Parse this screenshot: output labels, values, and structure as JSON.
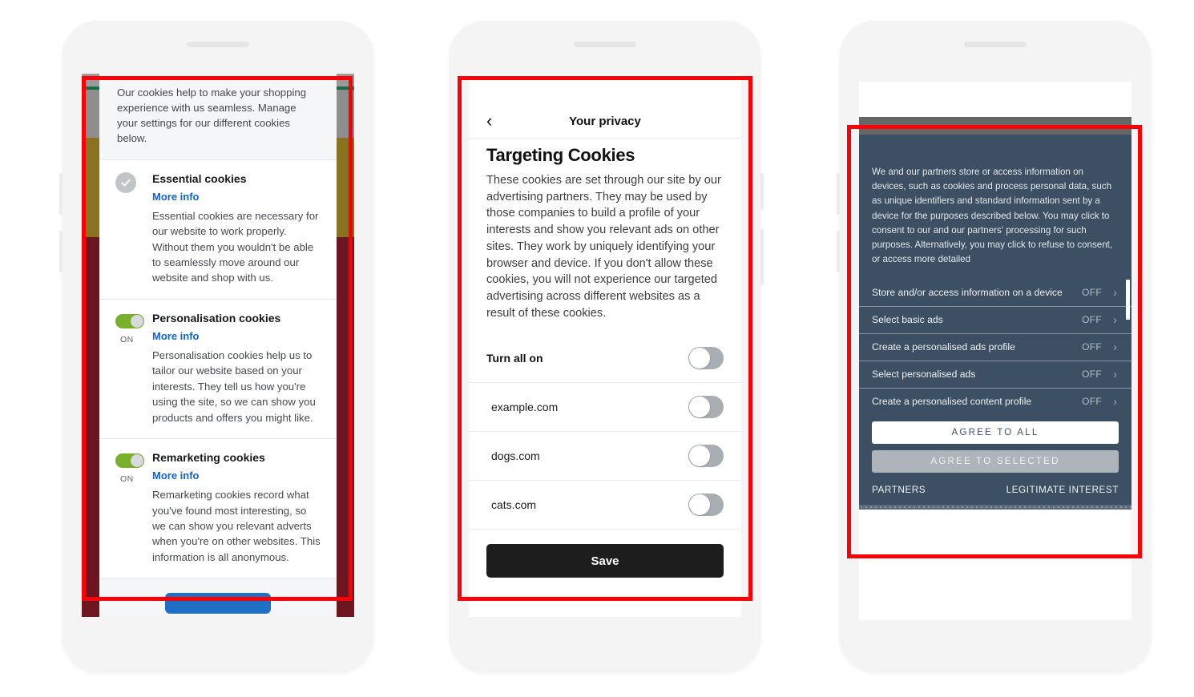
{
  "phone1": {
    "name": "cookie-settings-dialog",
    "intro": "Our cookies help to make your shopping experience with us seamless. Manage your settings for our different cookies below.",
    "sections": [
      {
        "title": "Essential cookies",
        "more_info": "More info",
        "control": "check-badge",
        "state_label": "",
        "description": "Essential cookies are necessary for our website to work properly. Without them you wouldn't be able to seamlessly move around our website and shop with us."
      },
      {
        "title": "Personalisation cookies",
        "more_info": "More info",
        "control": "toggle-on",
        "state_label": "ON",
        "description": "Personalisation cookies help us to tailor our website based on your interests. They tell us how you're using the site, so we can show you products and offers you might like."
      },
      {
        "title": "Remarketing cookies",
        "more_info": "More info",
        "control": "toggle-on",
        "state_label": "ON",
        "description": "Remarketing cookies record what you've found most interesting, so we can show you relevant adverts when you're on other websites. This information is all anonymous."
      }
    ],
    "footer_button_label": "",
    "colors": {
      "accent_link": "#1263d6",
      "toggle_on": "#77b02a",
      "footer_button": "#1f6fc4"
    }
  },
  "phone2": {
    "name": "targeting-cookies-screen",
    "back_icon": "‹",
    "header_title": "Your privacy",
    "heading": "Targeting Cookies",
    "paragraph": "These cookies are set through our site by our advertising partners. They may be used by those companies to build a profile of your interests and show you relevant ads on other sites. They work by uniquely identifying your browser and device. If you don't allow these cookies, you will not experience our targeted advertising across different websites as a result of these cookies.",
    "items": [
      {
        "label": "Turn all on",
        "bold": true,
        "toggle": "off"
      },
      {
        "label": "example.com",
        "bold": false,
        "toggle": "off"
      },
      {
        "label": "dogs.com",
        "bold": false,
        "toggle": "off"
      },
      {
        "label": "cats.com",
        "bold": false,
        "toggle": "off"
      }
    ],
    "save_label": "Save",
    "colors": {
      "save_button": "#1d1d1d",
      "toggle_off_track": "#a9aeb3"
    }
  },
  "phone3": {
    "name": "consent-management-banner",
    "intro": "We and our partners store or access information on devices, such as cookies and process personal data, such as unique identifiers and standard information sent by a device for the purposes described below. You may click to consent to our and our partners' processing for such purposes. Alternatively, you may click to refuse to consent, or access more detailed",
    "purposes": [
      {
        "label": "Store and/or access information on a device",
        "state": "OFF",
        "chevron": "›"
      },
      {
        "label": "Select basic ads",
        "state": "OFF",
        "chevron": "›"
      },
      {
        "label": "Create a personalised ads profile",
        "state": "OFF",
        "chevron": "›"
      },
      {
        "label": "Select personalised ads",
        "state": "OFF",
        "chevron": "›"
      },
      {
        "label": "Create a personalised content profile",
        "state": "OFF",
        "chevron": "›"
      }
    ],
    "agree_all_label": "AGREE TO ALL",
    "agree_selected_label": "AGREE TO SELECTED",
    "partners_label": "PARTNERS",
    "legitimate_interest_label": "LEGITIMATE INTEREST",
    "colors": {
      "panel": "#3d4f63",
      "top_band": "#666666",
      "agree_selected": "#aeb4b9"
    }
  },
  "highlight": {
    "color": "#fb0007"
  }
}
